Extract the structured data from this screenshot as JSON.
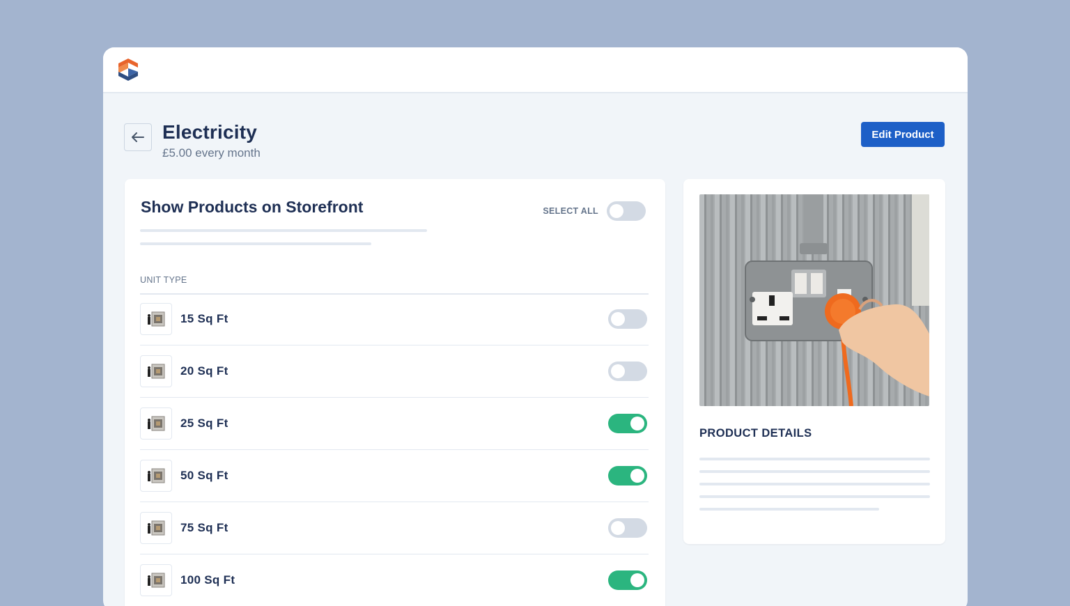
{
  "header": {
    "logo_icon": "brand-s-logo"
  },
  "product": {
    "title": "Electricity",
    "price": "£5.00 every month",
    "edit_label": "Edit Product"
  },
  "storefront": {
    "title": "Show Products on Storefront",
    "select_all_label": "SELECT ALL",
    "select_all_on": false,
    "column_header": "UNIT TYPE",
    "units": [
      {
        "label": "15 Sq Ft",
        "enabled": false
      },
      {
        "label": "20 Sq Ft",
        "enabled": false
      },
      {
        "label": "25 Sq Ft",
        "enabled": true
      },
      {
        "label": "50 Sq Ft",
        "enabled": true
      },
      {
        "label": "75 Sq Ft",
        "enabled": false
      },
      {
        "label": "100 Sq Ft",
        "enabled": true
      }
    ]
  },
  "details": {
    "title": "PRODUCT DETAILS",
    "image_icon": "socket-plug-photo"
  },
  "colors": {
    "accent": "#1d5fc7",
    "toggle_on": "#2bb57f",
    "toggle_off": "#d3dae4",
    "background": "#a3b4cf"
  }
}
